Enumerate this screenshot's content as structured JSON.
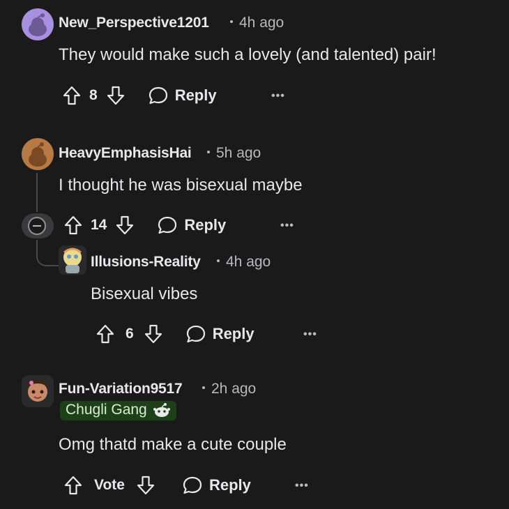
{
  "comments": [
    {
      "username": "New_Perspective1201",
      "time": "4h ago",
      "text": "They would make such a lovely (and talented) pair!",
      "votes": "8",
      "reply_label": "Reply",
      "more": "•••",
      "avatar_color": "#a98fe0"
    },
    {
      "username": "HeavyEmphasisHai",
      "time": "5h ago",
      "text": "I thought he was bisexual maybe",
      "votes": "14",
      "reply_label": "Reply",
      "more": "•••",
      "avatar_color": "#b87a45"
    },
    {
      "username": "Illusions-Reality",
      "time": "4h ago",
      "text": "Bisexual vibes",
      "votes": "6",
      "reply_label": "Reply",
      "more": "•••",
      "avatar_color": "#e9d98a"
    },
    {
      "username": "Fun-Variation9517",
      "time": "2h ago",
      "flair": "Chugli Gang",
      "text": "Omg thatd make a cute couple",
      "votes": "Vote",
      "reply_label": "Reply",
      "more": "•••",
      "avatar_color": "#c98a6a"
    }
  ],
  "colors": {
    "background": "#1a1a1b",
    "text": "#e8e8ea",
    "muted": "#b9b9bd",
    "flair_bg": "#1d4018"
  }
}
